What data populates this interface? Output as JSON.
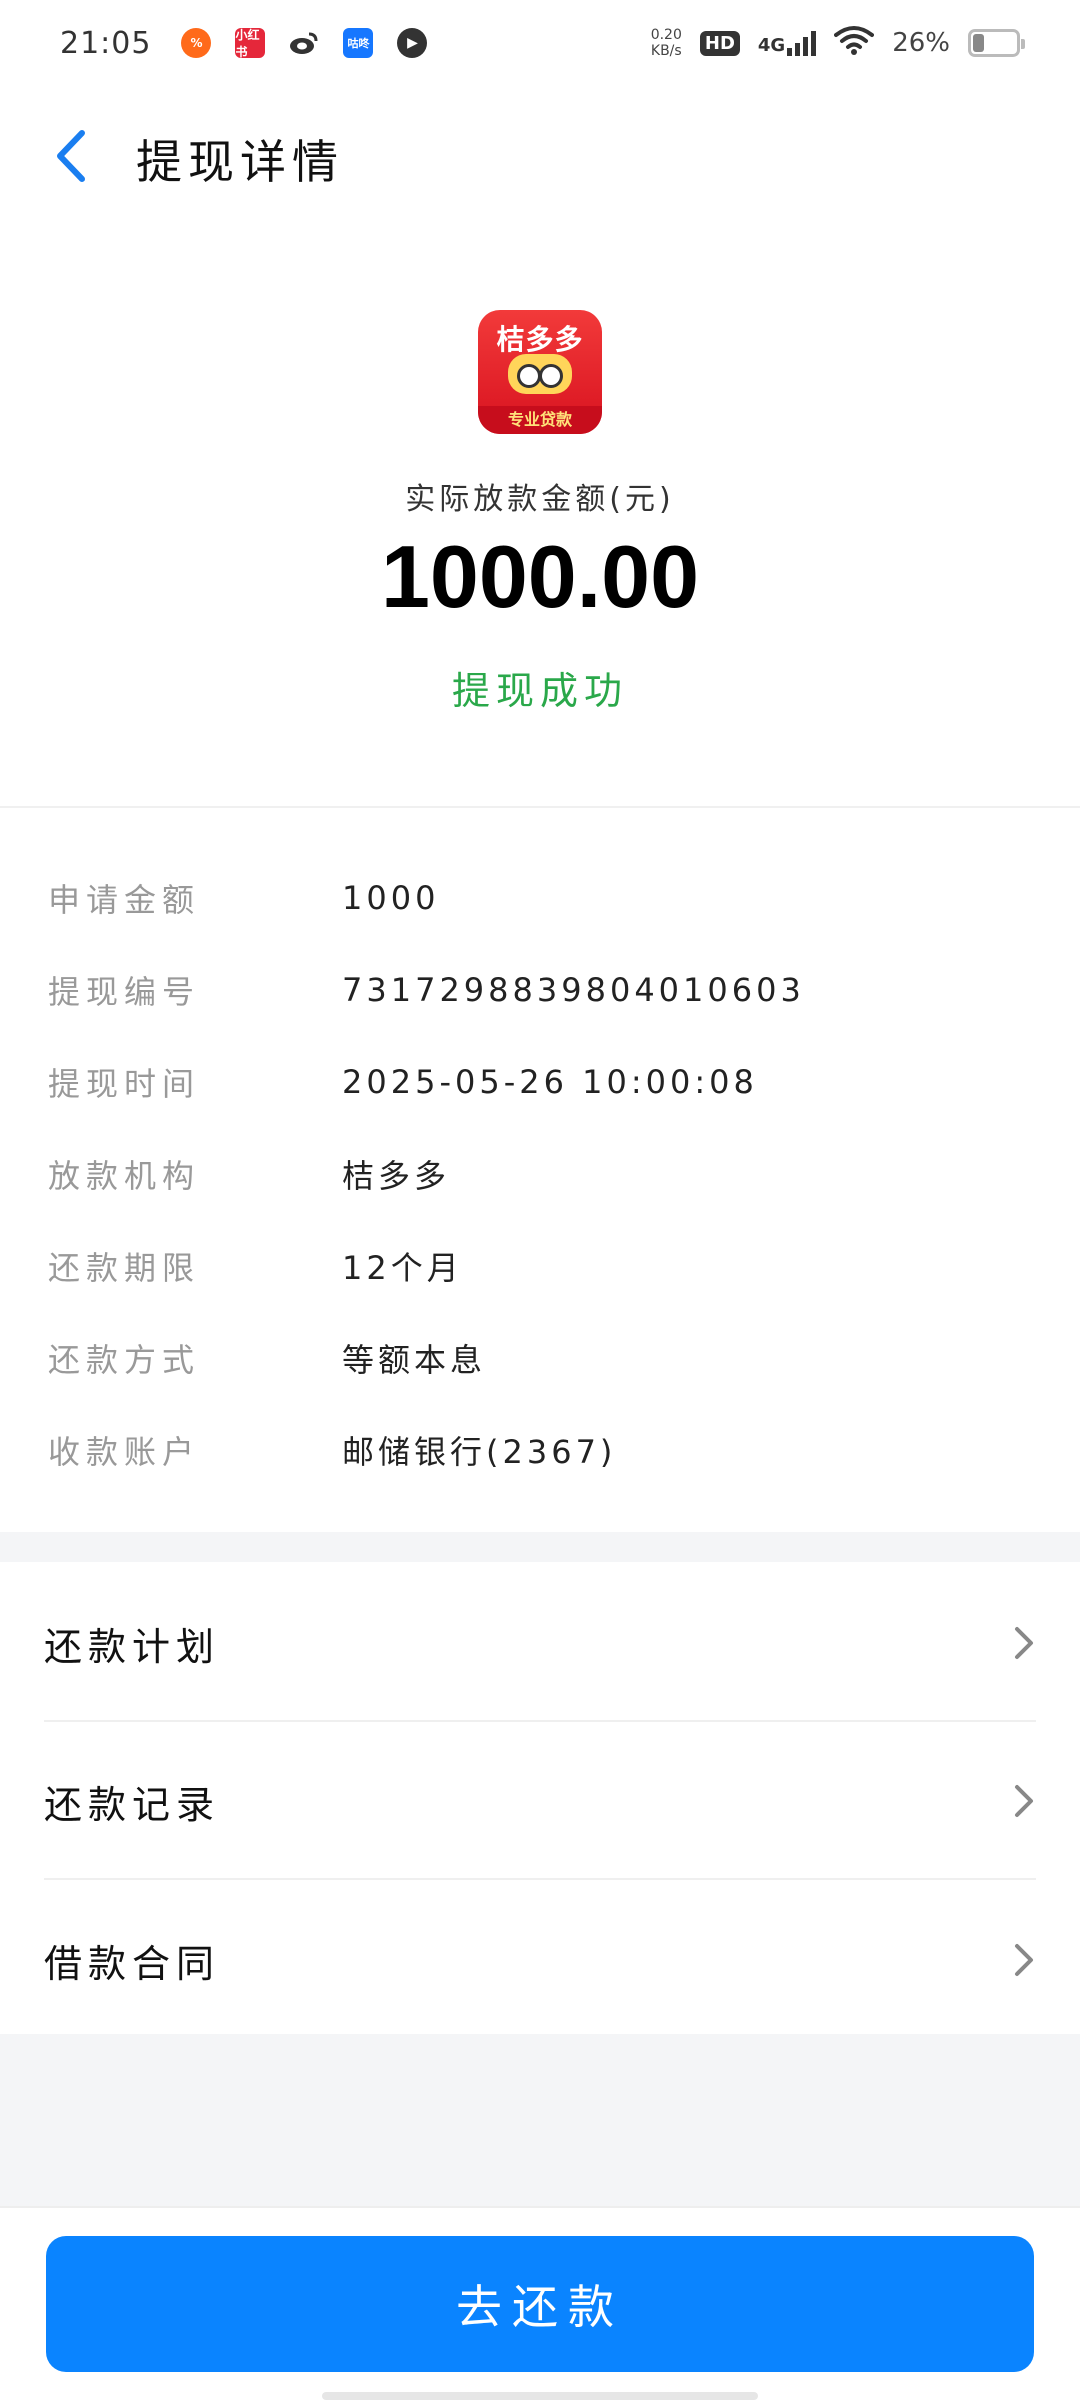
{
  "status_bar": {
    "time": "21:05",
    "notifications": [
      "%",
      "小红书",
      "",
      "咕咚",
      "▶"
    ],
    "speed_value": "0.20",
    "speed_unit": "KB/s",
    "hd": "HD",
    "network": "4G",
    "battery": "26%",
    "battery_level": 0.26
  },
  "header": {
    "title": "提现详情"
  },
  "hero": {
    "app_name": "桔多多",
    "app_tag": "专业贷款",
    "amount_label": "实际放款金额(元)",
    "amount": "1000.00",
    "status": "提现成功",
    "status_color": "#2aa84a"
  },
  "details": [
    {
      "label": "申请金额",
      "value": "1000"
    },
    {
      "label": "提现编号",
      "value": "7317298839804010603"
    },
    {
      "label": "提现时间",
      "value": "2025-05-26 10:00:08"
    },
    {
      "label": "放款机构",
      "value": "桔多多"
    },
    {
      "label": "还款期限",
      "value": "12个月"
    },
    {
      "label": "还款方式",
      "value": "等额本息"
    },
    {
      "label": "收款账户",
      "value": "邮储银行(2367)"
    }
  ],
  "nav": [
    {
      "label": "还款计划",
      "icon": "chevron-right-icon"
    },
    {
      "label": "还款记录",
      "icon": "chevron-right-icon"
    },
    {
      "label": "借款合同",
      "icon": "chevron-right-icon"
    }
  ],
  "bottom": {
    "repay_button": "去还款",
    "accent": "#0a84ff"
  }
}
